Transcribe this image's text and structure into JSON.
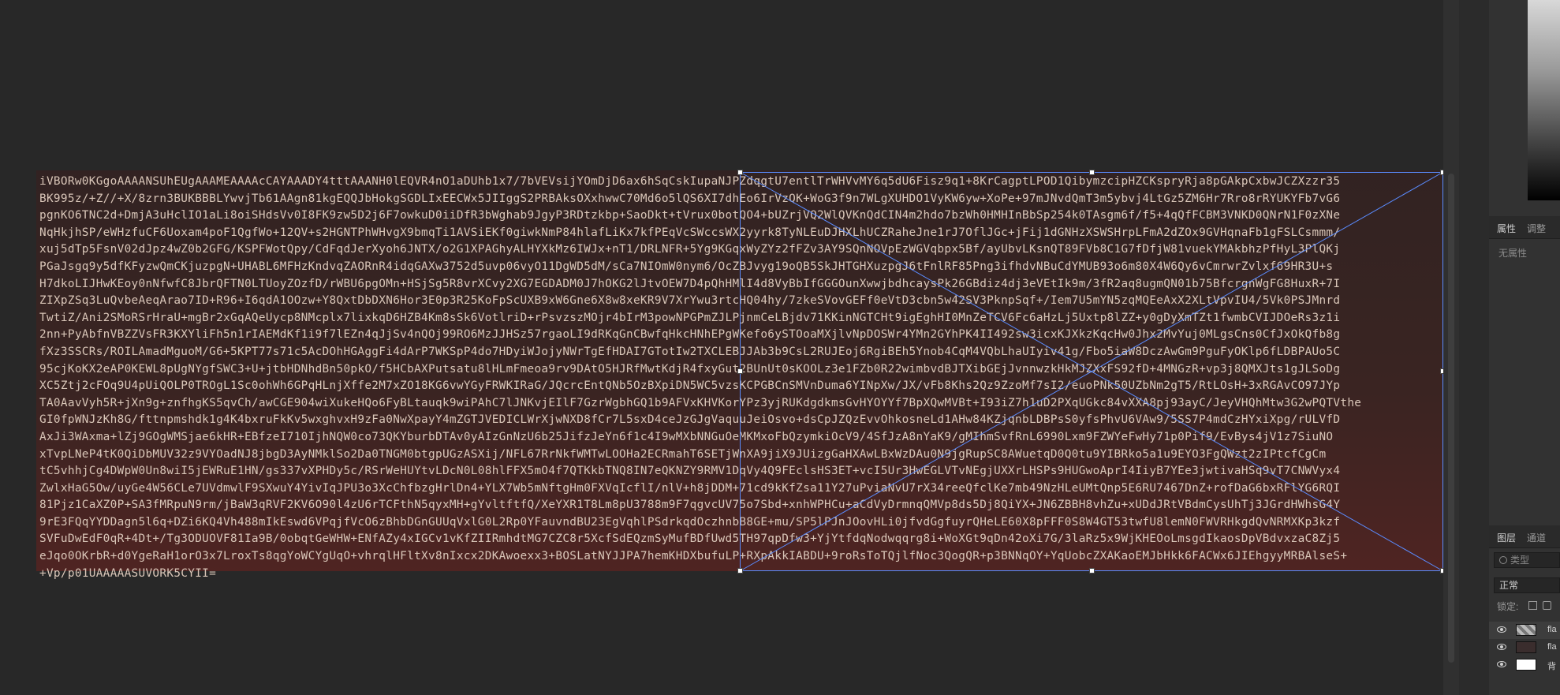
{
  "text_layer": {
    "lines": [
      "iVBORw0KGgoAAAANSUhEUgAAAMEAAAAcCAYAAADY4tttAAANH0lEQVR4nO1aDUhb1x7/7bVEVsijYOmDjD6ax6hSqCskIupaNJPZdqgtU7entlTrWHVvMY6q5dU6Fisz9q1+8KrCagptLPOD1QibymzcipHZCKspryRja8pGAkpCxbwJCZXzzr35",
      "BK995z/+Z//+X/8zrn3BUKBBBLYwvjTb61AAgn81kgEQQJbHokgSGDLIxEECWx5JIIggS2PRBAksOXxhwwC70Md6o5lQS6XI7dhEo6IrVzQK+WoG3f9n7WLgXUHDO1VyKW6yw+XoPe+97mJNvdQmT3m5ybvj4LtGz5ZM6Hr7Rro8rRYUKYFb7vG6",
      "pgnKO6TNC2d+DmjA3uHclIO1aLi8oiSHdsVv0I8FK9zw5D2j6F7owkuD0iiDfR3bWghab9JgyP3RDtzkbp+SaoDkt+tVrux0botQO4+bUZrjVQ2WlQVKnQdCIN4m2hdo7bzWh0HMHInBbSp254k0TAsgm6f/f5+4qQfFCBM3VNKD0QNrN1F0zXNe",
      "NqHkjhSP/eWHzfuCF6Uoxam4poF1QgfWo+12QV+s2HGNTPhWHvgX9bmqTi1AVSiEKf0giwkNmP84hlafLiKx7kfPEqVcSWccsWX2yyrk8TyNLEuDJHXLhUCZRaheJne1rJ7OflJGc+jFij1dGNHzXSWSHrpLFmA2dZOx9GVHqnaFb1gFSLCsmmm/",
      "xuj5dTp5FsnV02dJpz4wZ0b2GFG/KSPFWotQpy/CdFqdJerXyoh6JNTX/o2G1XPAGhyALHYXkMz6IWJx+nT1/DRLNFR+5Yg9KGqxWyZYz2fFZv3AY9SQnNOVpEzWGVqbpx5Bf/ayUbvLKsnQT89FVb8C1G7fDfjW81vuekYMAkbhzPfHyL3PlQKj",
      "PGaJsgq9y5dfKFyzwQmCKjuzpgN+UHABL6MFHzKndvqZAORnR4idqGAXw3752d5uvp06vyO11DgWD5dM/sCa7NIOmW0nym6/OcZBJvyg19oQB5SkJHTGHXuzpgJ6tFnlRF85Png3ifhdvNBuCdYMUB93o6m80X4W6Qy6vCmrwrZvlxf69HR3U+s",
      "H7dkoLIJHwKEoy0nNfwfC8JbrQFTN0LTUoyZOzfD/rWBU6pgOMn+HSjSg5R8vrXCvy2XG7EGDADM0J7hOKG2lJtvOEW7D4pQhHMlI4d8VyBbIfGGGOunXwwjbdhcaysPk26GBdiz4dj3eVEtIk9m/3fR2aq8ugmQN01b75BfcrgnWgFG8HuxR+7I",
      "ZIXpZSq3LuQvbeAeqArao7ID+R96+I6qdA1OOzw+Y8QxtDbDXN6Hor3E0p3R25KoFpScUXB9xW6Gne6X8w8xeKR9V7XrYwu3rtcHQ04hy/7zkeSVovGEFf0eVtD3cbn5w42SV3PknpSqf+/Iem7U5mYN5zqMQEeAxX2XLtVpvIU4/5Vk0PSJMnrd",
      "TwtiZ/Ani2SMoRSrHraU+mgBr2xGqAQeUycp8NMcplx7lixkqD6HZB4Km8sSk6VotlriD+rPsvzszMOjr4bIrM3powNPGPmZJLPjnmCeLBjdv71KKinNGTCHt9igEghHI0MnZeTCV6Fc6aHzLj5Uxtp8lZZ+y0gDyXmTZt1fwmbCVIJDOeRs3z1i",
      "2nn+PyAbfnVBZZVsFR3KXYliFh5n1rIAEMdKf1i9f7lEZn4qJjSv4nQOj99RO6MzJJHSz57rgaoLI9dRKqGnCBwfqHkcHNhEPgWKefo6ySTOoaMXjlvNpDOSWr4YMn2GYhPK4II492sw3icxKJXkzKqcHw0Jhx2MvYuj0MLgsCns0CfJxOkQfb8g",
      "fXz3SSCRs/ROILAmadMguoM/G6+5KPT77s71c5AcDOhHGAggFi4dArP7WKSpP4do7HDyiWJojyNWrTgEfHDAI7GTotIw2TXCLEBJJAb3b9CsL2RUJEoj6RgiBEh5Ynob4CqM4VQbLhaUIyiv41g/Fbo5iaW8DczAwGm9PguFyOKlp6fLDBPAUo5C",
      "95cjKoKX2eAP0KEWL8pUgNYgfSWC3+U+jtbHDNhdBn50pkO/f5HCbAXPutsatu8lHLmFmeoa9rv9DAtO5HJRfMwtKdjR4fxyGut2BUnUt0sKOOLz3e1FZb0R22wimbvdBJTXibGEjJvnnwzkHkMJZXxFS92fD+4MNGzR+vp3j8QMXJts1gJLSoDg",
      "XC5Ztj2cFOq9U4pUiQOLP0TROgL1Sc0ohWh6GPqHLnjXffe2M7xZO18KG6vwYGyFRWKIRaG/JQcrcEntQNb5OzBXpiDN5WC5vzsKCPGBCnSMVnDuma6YINpXw/JX/vFb8Khs2Qz9ZzoMf7sI2/euoPNk50UZbNm2gT5/RtLOsH+3xRGAvCO97JYp",
      "TA0AavVyh5R+jXn9g+znfhgKS5qvCh/awCGE904wiXukeHQo6FyBLtauqk9wiPAhC7lJNKvjEIlF7GzrWgbhGQ1b9AFVxKHVKorYPz3yjRUKdgdkmsGvHYOYYf7BpXQwMVBt+I93iZ7h1uD2PXqUGkc84vXXA8pj93ayC/JeyVHQhMtw3G2wPQTVthe",
      "GI0fpWNJzKh8G/fttnpmshdk1g4K4bxruFkKv5wxghvxH9zFa0NwXpayY4mZGTJVEDICLWrXjwNXD8fCr7L5sxD4ceJzGJgVaquuJeiOsvo+dsCpJZQzEvvOhkosneLd1AHw84KZjqnbLDBPsS0yfsPhvU6VAw9/5SS7P4mdCzHYxiXpg/rULVfD",
      "AxJi3WAxma+lZj9GOgWMSjae6kHR+EBfzeI710IjhNQW0co73QKYburbDTAv0yAIzGnNzU6b25JifzJeYn6f1c4I9wMXbNNGuOeMKMxoFbQzymkiOcV9/4SfJzA8nYaK9/gMIhmSvfRnL6990Lxm9FZWYeFwHy71p0Pif9/EvBys4jV1z7SiuNO",
      "xTvpLNeP4tK0QiDbMUV32z9VYOadNJ8jbgD3AyNMklSo2Da0TNGM0btgpUGzASXij/NFL67RrNkfWMTwLOOHa2ECRmahT6SETjWnXA9jiX9JUizgGaHXAwLBxWzDAu0N9jgRupSC8AWuetqD0Q0tu9YIBRko5a1u9EYO3FgQWzt2zIPtcfCgCm",
      "tC5vhhjCg4DWpW0Un8wiI5jEWRuE1HN/gs337vXPHDy5c/RSrWeHUYtvLDcN0L08hlFFX5mO4f7QTKkbTNQ8IN7eQKNZY9RMV1DqVy4Q9FEclsHS3ET+vcI5Ur3HwEGLVTvNEgjUXXrLHSPs9HUGwoAprI4IiyB7YEe3jwtivaHSq9vT7CNWVyx4",
      "ZwlxHaG5Ow/uyGe4W56CLe7UVdmwlF9SXwuY4YivIqJPU3o3XcChfbzgHrlDn4+YLX7Wb5mNftgHm0FXVqIcflI/nlV+h8jDDM+71cd9kKfZsa11Y27uPviaNvU7rX34reeQfclKe7mb49NzHLeUMtQnp5E6RU7467DnZ+rofDaG6bxRFlYG6RQI",
      "81Pjz1CaXZ0P+SA3fMRpuN9rm/jBaW3qRVF2KV6O90l4zU6rTCFthN5qyxMH+gYvltftfQ/XeYXR1T8Lm8pU3788m9F7qgvcUV75o7Sbd+xnhWPHCu+aCdVyDrmnqQMVp8ds5Dj8QiYX+JN6ZBBH8vhZu+xUDdJRtVBdmCysUhTj3JGrdHWhsG4Y",
      "9rE3FQqYYDDagn5l6q+DZi6KQ4Vh488mIkEswd6VPqjfVcO6zBhbDGnGUUqVxlG0L2Rp0YFauvndBU23EgVqhlPSdrkqdOczhnbB8GE+mu/SP5lPJnJOovHLi0jfvdGgfuyrQHeLE60X8pFFF0S8W4GT53twfU8lemN0FWVRHkgdQvNRMXKp3kzf",
      "SVFuDwEdF0qR+4Dt+/Tg3ODUOVF81Ia9B/0obqtGeWHW+ENfAZy4xIGCv1vKfZIIRmhdtMG7CZC8r5XcfSdEQzmSyMufBDfUwd5TH97qpDfw3+YjYtfdqNodwqqrg8i+WoXGt9qDn42oXi7G/3laRz5x9WjKHEOoLmsgdIkaosDpVBdvxzaC8Zj5",
      "eJqo0OKrbR+d0YgeRaH1orO3x7LroxTs8qgYoWCYgUqO+vhrqlHFltXv8nIxcx2DKAwoexx3+BOSLatNYJJPA7hemKHDXbufuLP+RXpAkkIABDU+9roRsToTQjlfNoc3QogQR+p3BNNqOY+YqUobcZXAKaoEMJbHkk6FACWx6JIEhgyyMRBAlseS+",
      "+Vp/p01UAAAAASUVORK5CYII="
    ]
  },
  "panel": {
    "tabs_top": [
      "属性",
      "调整"
    ],
    "no_properties": "无属性",
    "tabs_bottom": [
      "图层",
      "通道"
    ],
    "search_kind": "类型",
    "blend_mode": "正常",
    "lock_label": "锁定:",
    "layers": [
      {
        "name": "fla",
        "active": true
      },
      {
        "name": "fla",
        "active": false
      },
      {
        "name": "背",
        "active": false
      }
    ]
  }
}
